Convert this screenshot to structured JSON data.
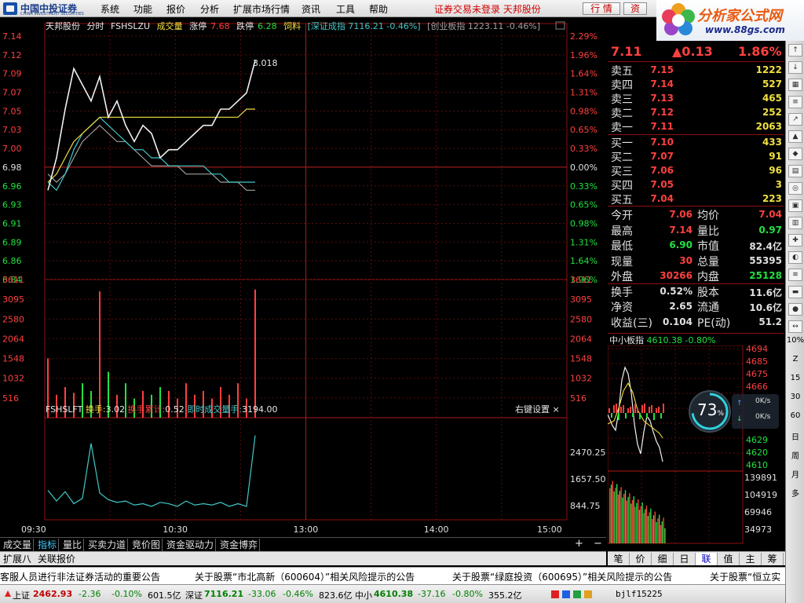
{
  "menu": {
    "logo_name": "中国中投证券",
    "logo_sub": "CHINA INVESTMENT SECURITIES",
    "items": [
      "系统",
      "功能",
      "报价",
      "分析",
      "扩展市场行情",
      "资讯",
      "工具",
      "帮助"
    ],
    "login_status": "证券交易未登录  天邦股份",
    "btn_quote": "行 情",
    "btn_trade": "资"
  },
  "ad": {
    "title": "分析家公式网",
    "url": "www.88gs.com"
  },
  "chart_title": {
    "stock": "天邦股份",
    "mode": "分时",
    "code": "FSHSLZU",
    "volume_label": "成交量",
    "limit_up_label": "涨停",
    "limit_up": "7.68",
    "limit_down_label": "跌停",
    "limit_down": "6.28",
    "feed": "饲料",
    "index1": "[深证成指 7116.21 -0.46%]",
    "index2": "[创业板指 1223.11 -0.46%]"
  },
  "price_axis": {
    "left_labels": [
      "7.14",
      "7.12",
      "7.09",
      "7.07",
      "7.05",
      "7.03",
      "7.00",
      "6.98",
      "6.96",
      "6.93",
      "6.91",
      "6.89",
      "6.86",
      "6.84"
    ],
    "right_labels": [
      "2.29%",
      "1.96%",
      "1.64%",
      "1.31%",
      "0.98%",
      "0.65%",
      "0.33%",
      "0.00%",
      "0.33%",
      "0.65%",
      "0.98%",
      "1.31%",
      "1.64%",
      "1.96%"
    ]
  },
  "vol_axis_labels": [
    "3611",
    "3095",
    "2580",
    "2064",
    "1548",
    "1032",
    "516"
  ],
  "sub_title": {
    "name": "FSHSLFT",
    "turnover_label": "换手:",
    "turnover": "3.02",
    "cum_label": "换手累计:",
    "cum": "0.52",
    "instant_label": "即时成交量手:",
    "instant": "3194.00",
    "settings": "右键设置 ×"
  },
  "sub_axis_labels": [
    "2470.25",
    "1657.50",
    "844.75"
  ],
  "time_labels": [
    "09:30",
    "10:30",
    "13:00",
    "14:00",
    "15:00"
  ],
  "last_vol_label": "3.018",
  "chart_data": {
    "type": "line",
    "title": "天邦股份 分时",
    "xlabel": "",
    "ylabel": "",
    "x": [
      "09:30",
      "09:35",
      "09:40",
      "09:45",
      "09:50",
      "09:55",
      "10:00",
      "10:05",
      "10:10",
      "10:15",
      "10:20",
      "10:25",
      "10:30",
      "10:35",
      "10:40",
      "10:45",
      "10:50",
      "10:55",
      "11:00",
      "11:05",
      "11:10",
      "11:15",
      "11:20",
      "11:25",
      "11:30"
    ],
    "ylim": [
      6.84,
      7.14
    ],
    "prev_close": 6.98,
    "series": [
      {
        "name": "price",
        "values": [
          6.95,
          6.99,
          7.05,
          7.1,
          7.08,
          7.06,
          7.09,
          7.04,
          7.06,
          7.03,
          7.01,
          7.03,
          7.02,
          6.99,
          7.0,
          7.0,
          7.01,
          7.02,
          7.03,
          7.03,
          7.05,
          7.05,
          7.06,
          7.07,
          7.11
        ]
      },
      {
        "name": "avg",
        "values": [
          6.96,
          6.97,
          6.99,
          7.01,
          7.02,
          7.03,
          7.04,
          7.04,
          7.04,
          7.04,
          7.04,
          7.04,
          7.04,
          7.04,
          7.04,
          7.04,
          7.04,
          7.04,
          7.04,
          7.04,
          7.04,
          7.04,
          7.04,
          7.05,
          7.05
        ]
      },
      {
        "name": "index1",
        "values": [
          6.96,
          6.95,
          6.97,
          7.0,
          7.02,
          7.03,
          7.04,
          7.03,
          7.02,
          7.01,
          7.0,
          7.0,
          6.99,
          6.99,
          6.98,
          6.98,
          6.98,
          6.98,
          6.98,
          6.97,
          6.97,
          6.96,
          6.96,
          6.96,
          6.96
        ]
      },
      {
        "name": "index2",
        "values": [
          6.97,
          6.96,
          6.97,
          6.99,
          7.01,
          7.02,
          7.03,
          7.02,
          7.01,
          7.01,
          7.0,
          6.99,
          6.98,
          6.98,
          6.98,
          6.98,
          6.97,
          6.97,
          6.97,
          6.97,
          6.96,
          6.96,
          6.96,
          6.95,
          6.95
        ]
      }
    ],
    "volume": [
      1550,
      600,
      800,
      650,
      900,
      700,
      3300,
      1200,
      600,
      900,
      500,
      700,
      600,
      800,
      700,
      500,
      900,
      600,
      700,
      500,
      800,
      600,
      900,
      500,
      3350
    ],
    "turnover_sub": [
      1100,
      700,
      1050,
      600,
      800,
      2850,
      1000,
      750,
      650,
      700,
      550,
      600,
      500,
      650,
      600,
      500,
      700,
      550,
      600,
      550,
      650,
      500,
      600,
      500,
      3150
    ],
    "sub_ylim": [
      0,
      3283
    ]
  },
  "quote": {
    "price": "7.11",
    "change": "▲0.13",
    "pct": "1.86%",
    "sells": [
      {
        "label": "卖五",
        "price": "7.15",
        "vol": "1222"
      },
      {
        "label": "卖四",
        "price": "7.14",
        "vol": "527"
      },
      {
        "label": "卖三",
        "price": "7.13",
        "vol": "465"
      },
      {
        "label": "卖二",
        "price": "7.12",
        "vol": "252"
      },
      {
        "label": "卖一",
        "price": "7.11",
        "vol": "2063"
      }
    ],
    "buys": [
      {
        "label": "买一",
        "price": "7.10",
        "vol": "433"
      },
      {
        "label": "买二",
        "price": "7.07",
        "vol": "91"
      },
      {
        "label": "买三",
        "price": "7.06",
        "vol": "96"
      },
      {
        "label": "买四",
        "price": "7.05",
        "vol": "3"
      },
      {
        "label": "买五",
        "price": "7.04",
        "vol": "223"
      }
    ],
    "stats": [
      {
        "l1": "今开",
        "v1": "7.06",
        "l2": "均价",
        "v2": "7.04"
      },
      {
        "l1": "最高",
        "v1": "7.14",
        "l2": "量比",
        "v2": "0.97"
      },
      {
        "l1": "最低",
        "v1": "6.90",
        "l2": "市值",
        "v2": "82.4亿"
      },
      {
        "l1": "现量",
        "v1": "30",
        "l2": "总量",
        "v2": "55395"
      },
      {
        "l1": "外盘",
        "v1": "30266",
        "l2": "内盘",
        "v2": "25128"
      },
      {
        "l1": "换手",
        "v1": "0.52%",
        "l2": "股本",
        "v2": "11.6亿"
      },
      {
        "l1": "净资",
        "v1": "2.65",
        "l2": "流通",
        "v2": "10.6亿"
      },
      {
        "l1": "收益(三)",
        "v1": "0.104",
        "l2": "PE(动)",
        "v2": "51.2"
      }
    ]
  },
  "mini_index": {
    "name": "中小板指",
    "value": "4610.38",
    "pct": "-0.80%",
    "price_labels": [
      "4694",
      "4685",
      "4675",
      "4666",
      "4629",
      "4620",
      "4610"
    ],
    "vol_labels": [
      "139891",
      "104919",
      "69946",
      "34973"
    ]
  },
  "speed": {
    "pct": "73",
    "up": "0K/s",
    "down": "0K/s"
  },
  "bottom_tabs": [
    "成交量",
    "指标",
    "量比",
    "买卖力道",
    "竞价图",
    "资金驱动力",
    "资金博弈"
  ],
  "bottom_tabs2": [
    "扩展八",
    "关联报价"
  ],
  "right_tabs": [
    "笔",
    "价",
    "细",
    "日",
    "联",
    "值",
    "主",
    "筹"
  ],
  "news": [
    "客服人员进行非法证券活动的重要公告",
    "关于股票“市北高新（600604）”相关风险提示的公告",
    "关于股票“绿庭投资（600695）”相关风险提示的公告",
    "关于股票“恒立实"
  ],
  "status": {
    "sh_label": "上证",
    "sh": "2462.93",
    "sh_chg": "-2.36",
    "sh_pct": "-0.10%",
    "sh_amt": "601.5亿",
    "sz_label": "深证",
    "sz": "7116.21",
    "sz_chg": "-33.06",
    "sz_pct": "-0.46%",
    "sz_amt": "823.6亿",
    "zx_label": "中小",
    "zx": "4610.38",
    "zx_chg": "-37.16",
    "zx_pct": "-0.80%",
    "zx_amt": "355.2亿",
    "user": "bjlf15225"
  },
  "side_labels": [
    "10%",
    "Z",
    "15",
    "30",
    "60",
    "日",
    "周",
    "月",
    "多"
  ],
  "colors": {
    "red": "#ff4040",
    "green": "#22e040",
    "yellow": "#f0e040",
    "grid": "#8c1010",
    "cyan": "#40c8c8"
  }
}
